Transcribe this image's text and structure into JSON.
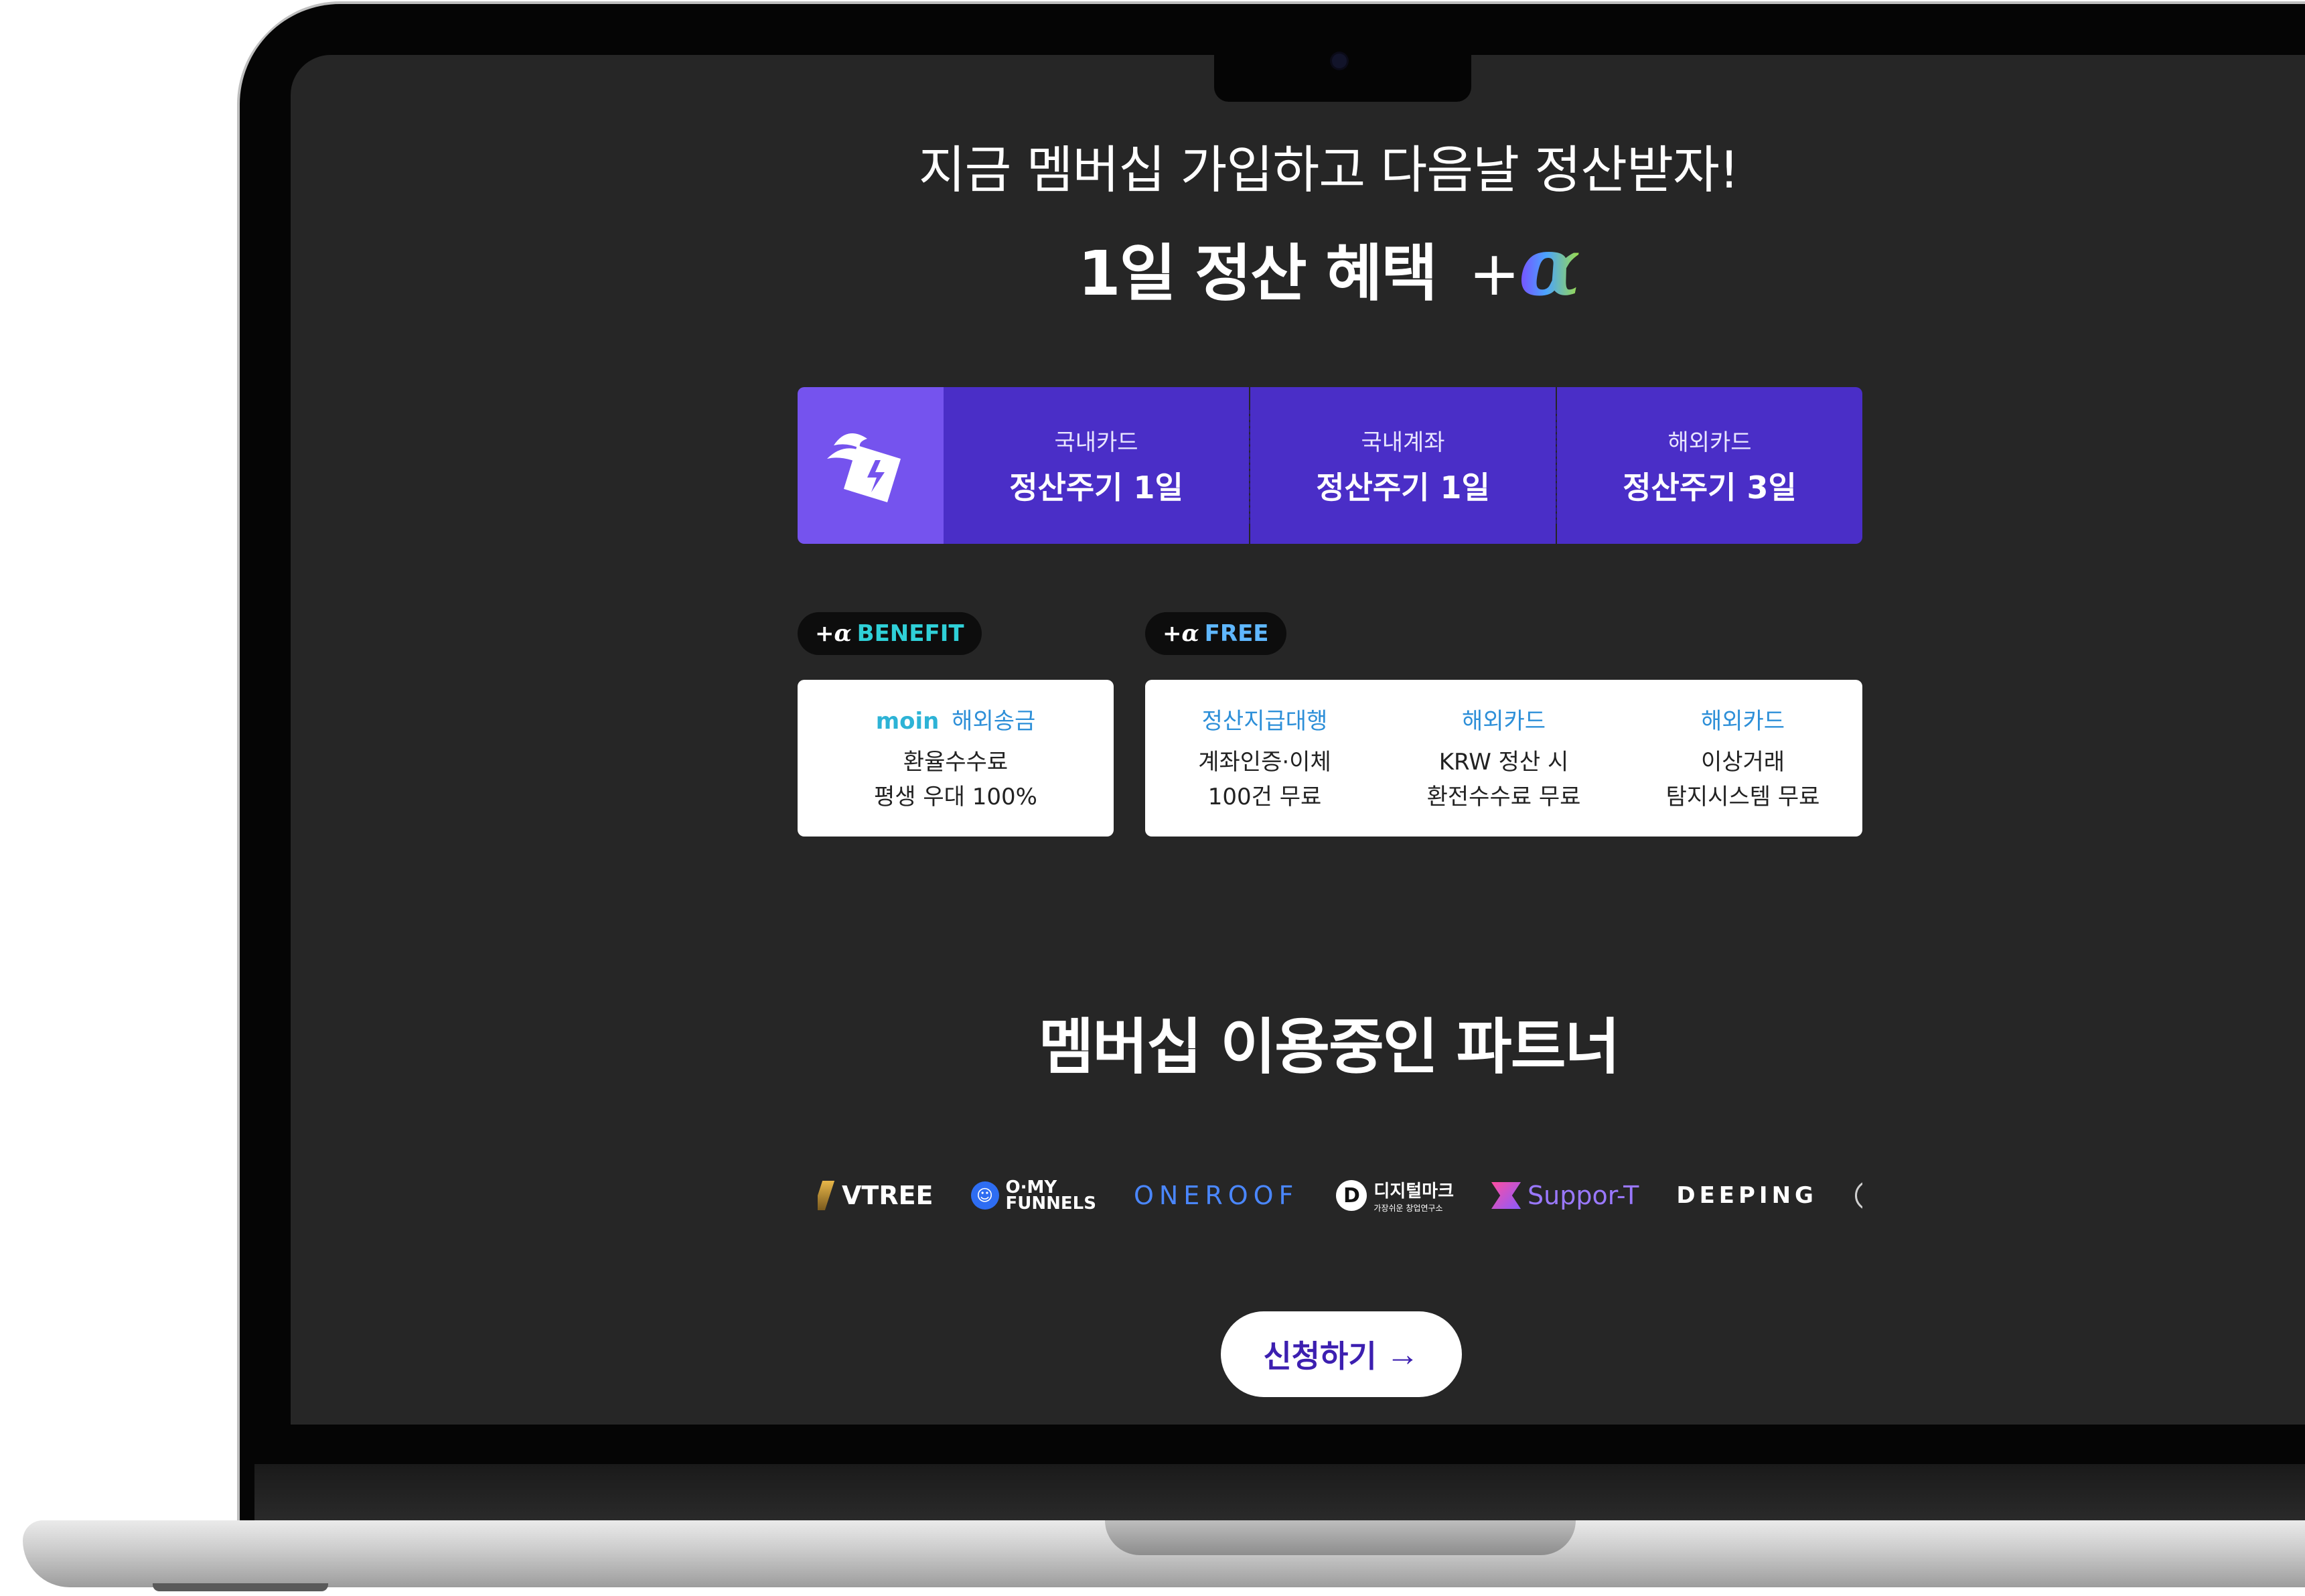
{
  "hero": {
    "headline": "지금 멤버십 가입하고 다음날 정산받자!",
    "subhead_main": "1일 정산 혜택",
    "subhead_plus": "+",
    "subhead_alpha": "α"
  },
  "settlement_strip": {
    "icon": "winged-bill-icon",
    "items": [
      {
        "label": "국내카드",
        "value": "정산주기 1일"
      },
      {
        "label": "국내계좌",
        "value": "정산주기 1일"
      },
      {
        "label": "해외카드",
        "value": "정산주기 3일"
      }
    ]
  },
  "benefit": {
    "tag_prefix": "+α",
    "tag_label": "BENEFIT",
    "brand": "moin",
    "head": "해외송금",
    "lines": [
      "환율수수료",
      "평생 우대 100%"
    ]
  },
  "free": {
    "tag_prefix": "+α",
    "tag_label": "FREE",
    "items": [
      {
        "head": "정산지급대행",
        "lines": [
          "계좌인증·이체",
          "100건 무료"
        ]
      },
      {
        "head": "해외카드",
        "lines": [
          "KRW 정산 시",
          "환전수수료 무료"
        ]
      },
      {
        "head": "해외카드",
        "lines": [
          "이상거래",
          "탐지시스템 무료"
        ]
      }
    ]
  },
  "partners": {
    "title": "멤버십 이용중인 파트너",
    "logos": [
      {
        "name": "VTREE"
      },
      {
        "name_top": "O·MY",
        "name_bottom": "FUNNELS"
      },
      {
        "name": "ONEROOF"
      },
      {
        "mark": "D",
        "name": "디지털마크",
        "sub": "가장쉬운 창업연구소"
      },
      {
        "name": "Suppor-T"
      },
      {
        "name": "DEEPING"
      },
      {
        "name": "수플"
      }
    ]
  },
  "cta": {
    "label": "신청하기",
    "arrow": "→"
  },
  "colors": {
    "screen_bg": "#262626",
    "strip_primary": "#4a2ec7",
    "strip_icon_bg": "#7553ee",
    "benefit_accent": "#2fd0d8",
    "free_accent": "#5fb7ff",
    "cta_text": "#3c1fb0"
  }
}
